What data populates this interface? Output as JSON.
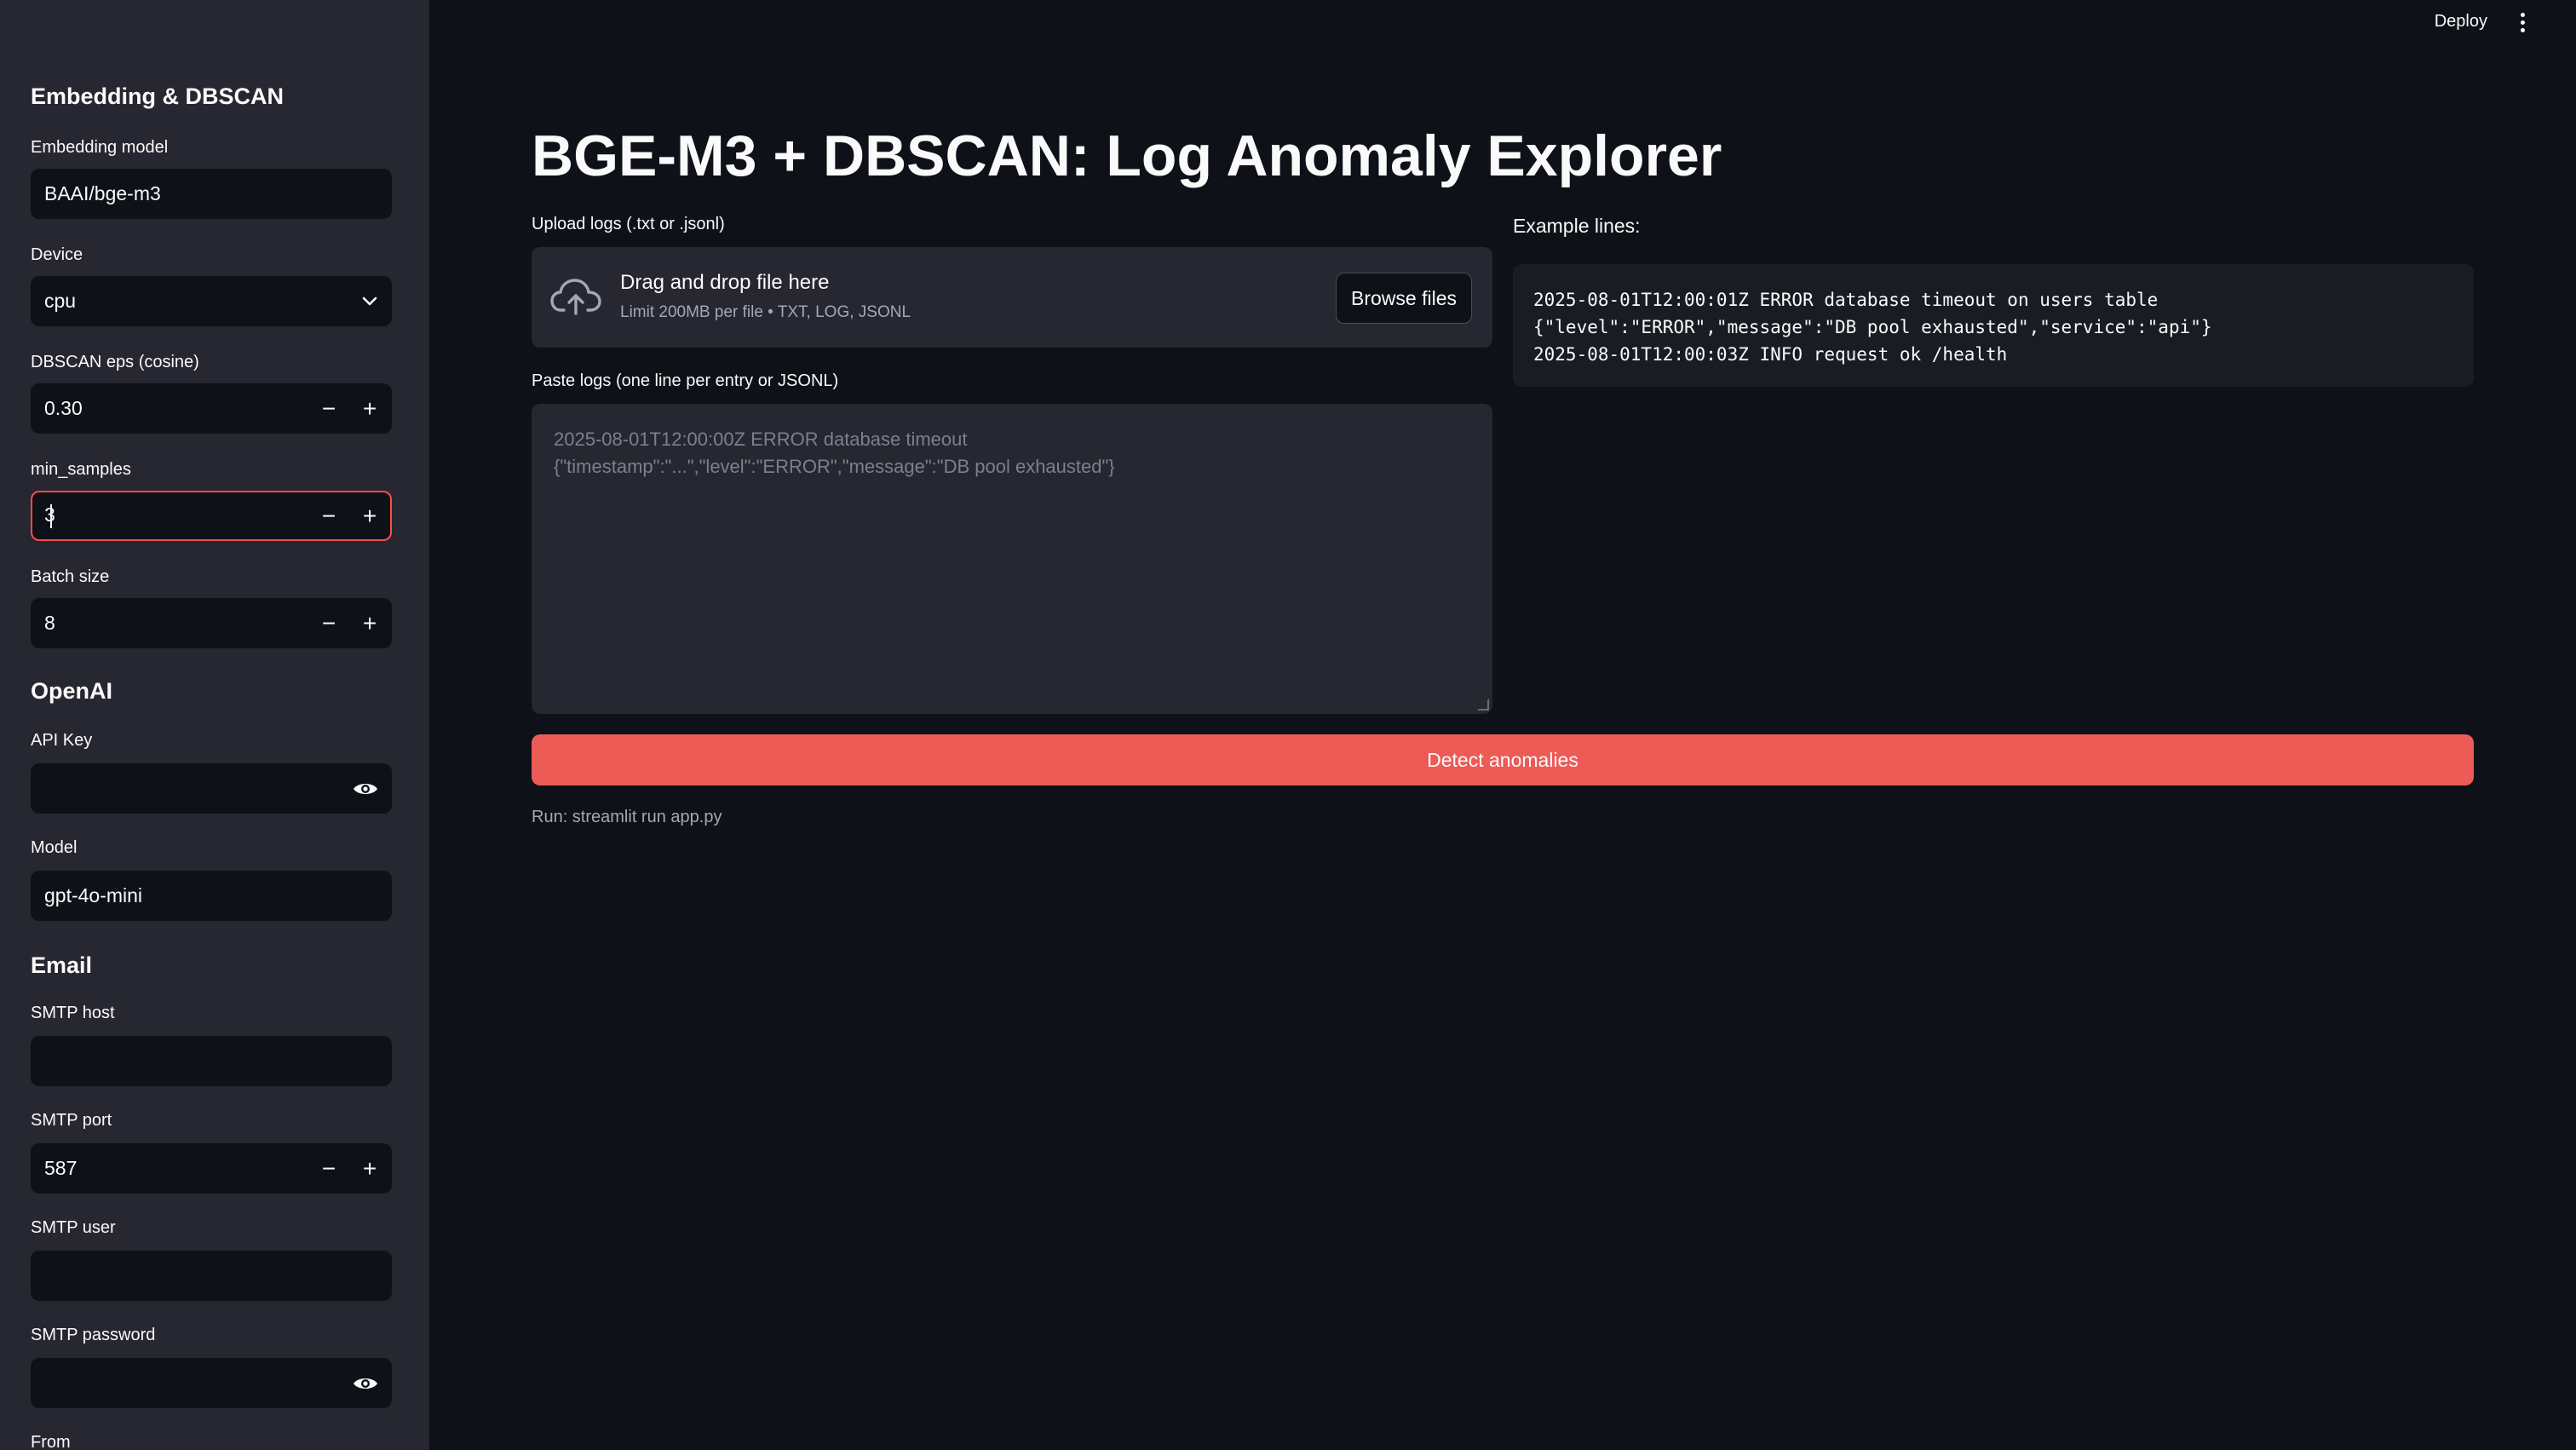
{
  "header": {
    "deploy_label": "Deploy",
    "menu_icon": "kebab-menu-icon"
  },
  "sidebar": {
    "embedding_section": "Embedding & DBSCAN",
    "embedding_model_label": "Embedding model",
    "embedding_model_value": "BAAI/bge-m3",
    "device_label": "Device",
    "device_value": "cpu",
    "eps_label": "DBSCAN eps (cosine)",
    "eps_value": "0.30",
    "min_samples_label": "min_samples",
    "min_samples_value": "3",
    "batch_label": "Batch size",
    "batch_value": "8",
    "openai_section": "OpenAI",
    "api_key_label": "API Key",
    "api_key_value": "",
    "model_label": "Model",
    "model_value": "gpt-4o-mini",
    "email_section": "Email",
    "smtp_host_label": "SMTP host",
    "smtp_host_value": "",
    "smtp_port_label": "SMTP port",
    "smtp_port_value": "587",
    "smtp_user_label": "SMTP user",
    "smtp_user_value": "",
    "smtp_password_label": "SMTP password",
    "smtp_password_value": "",
    "from_label": "From",
    "minus": "−",
    "plus": "+"
  },
  "main": {
    "title": "BGE-M3 + DBSCAN: Log Anomaly Explorer",
    "upload_label": "Upload logs (.txt or .jsonl)",
    "drop_title": "Drag and drop file here",
    "drop_sub": "Limit 200MB per file • TXT, LOG, JSONL",
    "browse_label": "Browse files",
    "paste_label": "Paste logs (one line per entry or JSONL)",
    "paste_placeholder": "2025-08-01T12:00:00Z ERROR database timeout\n{\"timestamp\":\"...\",\"level\":\"ERROR\",\"message\":\"DB pool exhausted\"}",
    "example_label": "Example lines:",
    "example_code": "2025-08-01T12:00:01Z ERROR database timeout on users table\n{\"level\":\"ERROR\",\"message\":\"DB pool exhausted\",\"service\":\"api\"}\n2025-08-01T12:00:03Z INFO request ok /health",
    "detect_label": "Detect anomalies",
    "run_hint": "Run: streamlit run app.py"
  },
  "colors": {
    "background": "#0e1117",
    "sidebar": "#262730",
    "accent": "#ff4b4b",
    "button": "#ed5b57"
  }
}
